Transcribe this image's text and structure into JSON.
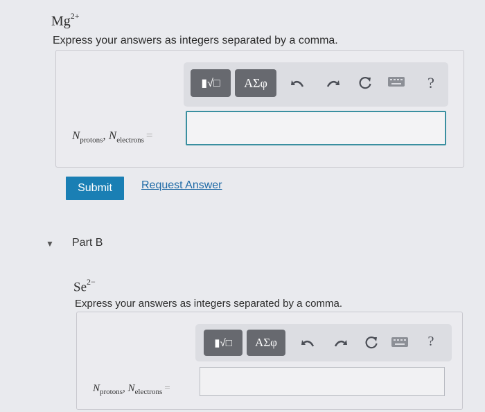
{
  "part_a": {
    "ion_base": "Mg",
    "ion_charge": "2+",
    "instruction": "Express your answers as integers separated by a comma.",
    "toolbar": {
      "template_label": "▮√□",
      "greek_label": "ΑΣφ",
      "undo_icon": "undo-icon",
      "redo_icon": "redo-icon",
      "reset_icon": "reset-icon",
      "keyboard_icon": "keyboard-icon",
      "help_label": "?"
    },
    "label": {
      "n1": "N",
      "sub1": "protons",
      "sep": ", ",
      "n2": "N",
      "sub2": "electrons",
      "eq": "="
    },
    "input_value": "",
    "submit_label": "Submit",
    "request_label": "Request Answer"
  },
  "part_b": {
    "section_label": "Part B",
    "ion_base": "Se",
    "ion_charge": "2−",
    "instruction": "Express your answers as integers separated by a comma.",
    "toolbar": {
      "template_label": "▮√□",
      "greek_label": "ΑΣφ",
      "help_label": "?"
    },
    "label": {
      "n1": "N",
      "sub1": "protons",
      "sep": ", ",
      "n2": "N",
      "sub2": "electrons",
      "eq": "="
    },
    "input_value": ""
  },
  "colors": {
    "accent_button": "#1a7fb4",
    "link": "#1f6aa6",
    "input_focus_border": "#3a8fa0",
    "toolbar_button": "#67696f"
  }
}
